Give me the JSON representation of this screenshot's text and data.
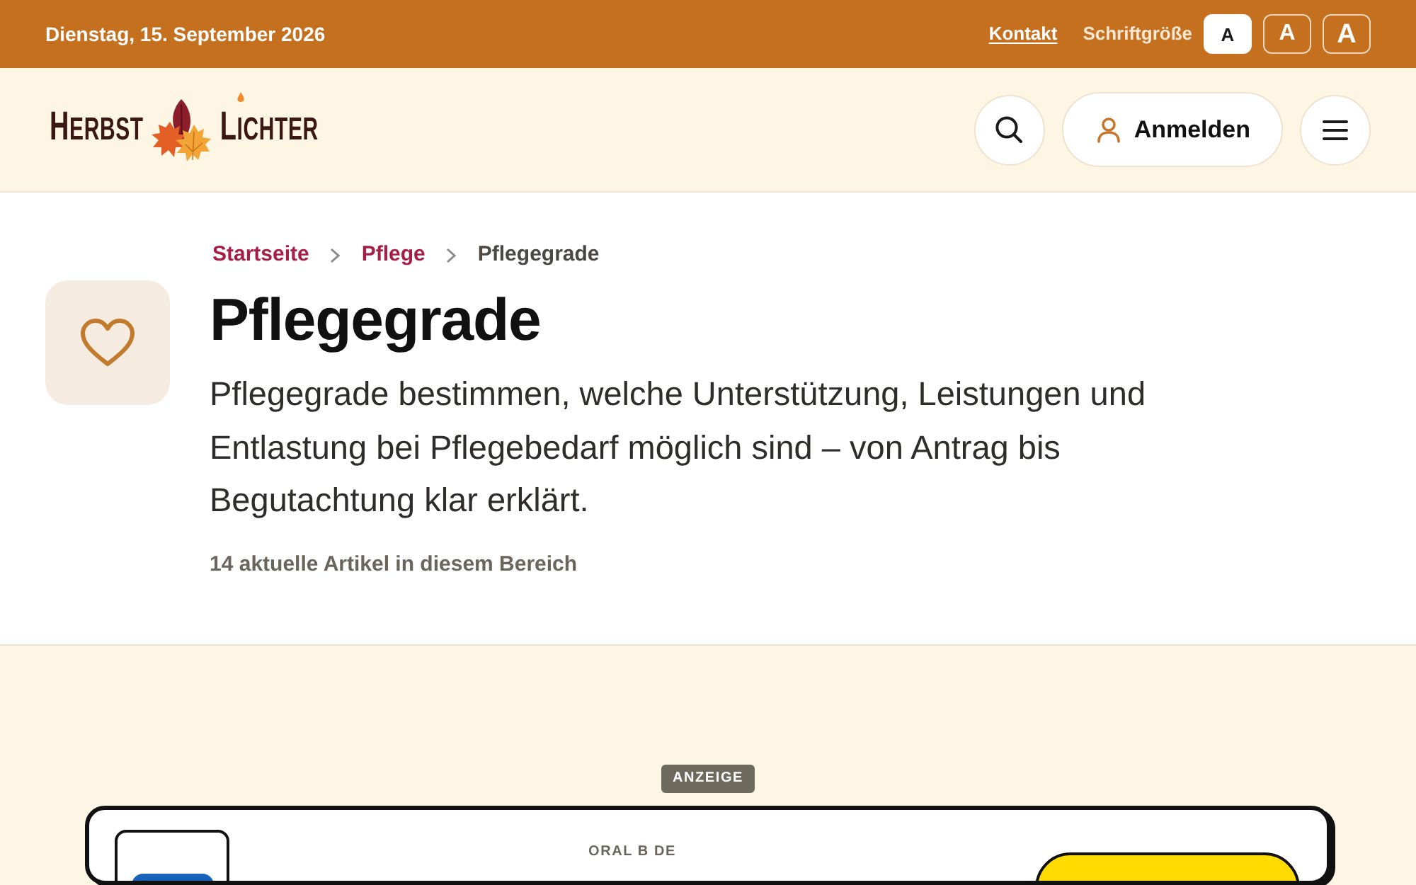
{
  "top_bar": {
    "date": "Dienstag, 15. September 2026",
    "contact_link": "Kontakt",
    "font_size": {
      "label": "Schriftgröße",
      "options": [
        {
          "label": "A",
          "selected": true
        },
        {
          "label": "A",
          "selected": false
        },
        {
          "label": "A",
          "selected": false
        }
      ]
    }
  },
  "header": {
    "logo": {
      "words": [
        "HERBST",
        "LICHTER"
      ]
    },
    "login_button": {
      "label": "Anmelden"
    }
  },
  "page": {
    "breadcrumb": [
      {
        "label": "Startseite",
        "current": false
      },
      {
        "label": "Pflege",
        "current": false
      },
      {
        "label": "Pflegegrade",
        "current": true
      }
    ],
    "title": "Pflegegrade",
    "description": "Pflegegrade bestimmen, welche Unterstützung, Leistungen und Entlastung bei Pflegebedarf möglich sind – von Antrag bis Begutachtung klar erklärt.",
    "article_count": "14 aktuelle Artikel in diesem Bereich"
  },
  "ad": {
    "badge": "ANZEIGE",
    "advertiser": "ORAL B DE"
  }
}
